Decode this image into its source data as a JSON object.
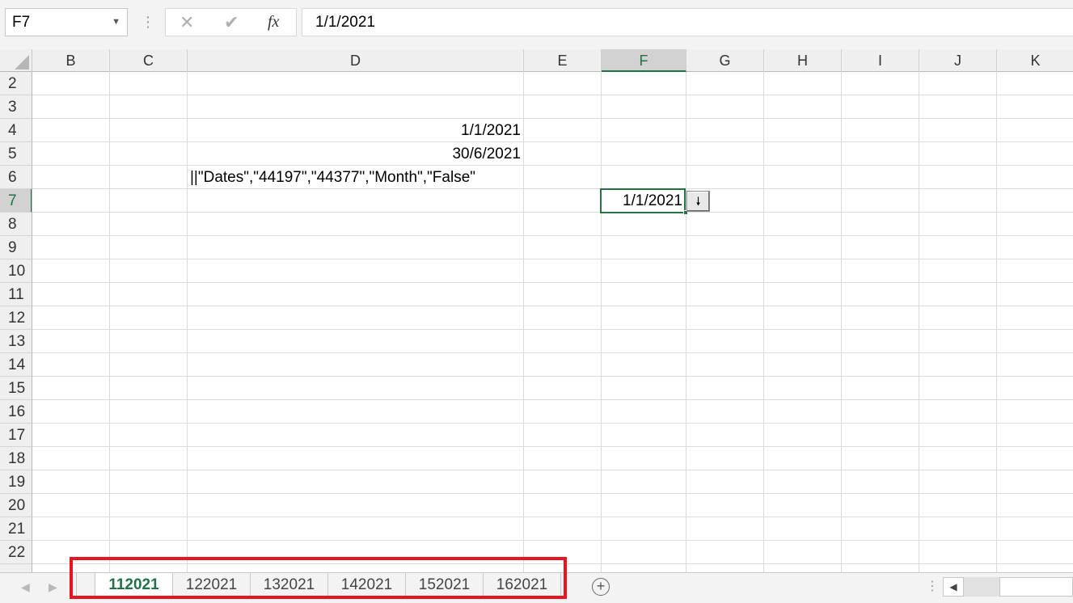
{
  "name_box": {
    "value": "F7"
  },
  "formula_bar": {
    "fx_label": "fx",
    "value": "1/1/2021"
  },
  "columns": [
    "B",
    "C",
    "D",
    "E",
    "F",
    "G",
    "H",
    "I",
    "J",
    "K"
  ],
  "active_column": "F",
  "rows": [
    "2",
    "3",
    "4",
    "5",
    "6",
    "7",
    "8",
    "9",
    "10",
    "11",
    "12",
    "13",
    "14",
    "15",
    "16",
    "17",
    "18",
    "19",
    "20",
    "21",
    "22"
  ],
  "active_row": "7",
  "cells": {
    "D4": "1/1/2021",
    "D5": "30/6/2021",
    "D6": "||\"Dates\",\"44197\",\"44377\",\"Month\",\"False\"",
    "F7": "1/1/2021"
  },
  "dropdown_arrow": "🠗",
  "sheet_tabs": [
    {
      "label": "112021",
      "active": true
    },
    {
      "label": "122021",
      "active": false
    },
    {
      "label": "132021",
      "active": false
    },
    {
      "label": "142021",
      "active": false
    },
    {
      "label": "152021",
      "active": false
    },
    {
      "label": "162021",
      "active": false
    }
  ],
  "colors": {
    "accent": "#217346",
    "highlight_box": "#e8141e"
  }
}
